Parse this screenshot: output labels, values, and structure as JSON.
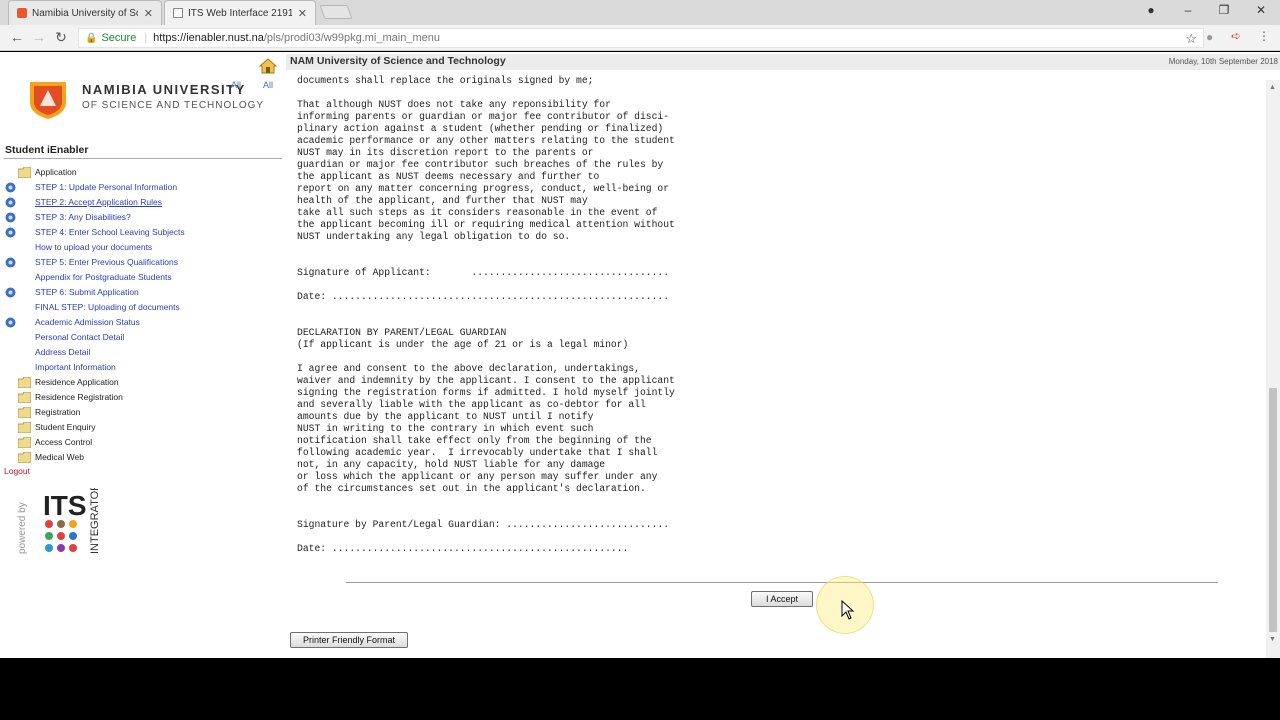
{
  "browser": {
    "tabs": [
      {
        "title": "Namibia University of Sci",
        "active": false
      },
      {
        "title": "ITS Web Interface 21911",
        "active": true
      }
    ],
    "secure_label": "Secure",
    "url_host": "https://ienabler.nust.na",
    "url_path": "/pls/prodi03/w99pkg.mi_main_menu"
  },
  "sidebar": {
    "logo_line1": "NAMIBIA UNIVERSITY",
    "logo_line2": "OF SCIENCE AND TECHNOLOGY",
    "all_links": [
      "All",
      "All"
    ],
    "title": "Student iEnabler",
    "menu": [
      {
        "label": "Application",
        "type": "folder"
      },
      {
        "label": "STEP 1: Update Personal Information",
        "type": "step"
      },
      {
        "label": "STEP 2: Accept Application Rules",
        "type": "step",
        "current": true
      },
      {
        "label": "STEP 3: Any Disabilities?",
        "type": "step"
      },
      {
        "label": "STEP 4: Enter School Leaving Subjects",
        "type": "step"
      },
      {
        "label": "How to upload your documents",
        "type": "link"
      },
      {
        "label": "STEP 5: Enter Previous Qualifications",
        "type": "step"
      },
      {
        "label": "Appendix for Postgraduate Students",
        "type": "link"
      },
      {
        "label": "STEP 6: Submit Application",
        "type": "step"
      },
      {
        "label": "FINAL STEP: Uploading of documents",
        "type": "link"
      },
      {
        "label": "Academic Admission Status",
        "type": "step"
      },
      {
        "label": "Personal Contact Detail",
        "type": "link"
      },
      {
        "label": "Address Detail",
        "type": "link"
      },
      {
        "label": "Important Information",
        "type": "link"
      },
      {
        "label": "Residence Application",
        "type": "folder"
      },
      {
        "label": "Residence Registration",
        "type": "folder"
      },
      {
        "label": "Registration",
        "type": "folder"
      },
      {
        "label": "Student Enquiry",
        "type": "folder"
      },
      {
        "label": "Access Control",
        "type": "folder"
      },
      {
        "label": "Medical Web",
        "type": "folder"
      }
    ],
    "logout": "Logout",
    "powered_by": "powered by",
    "its": "ITS",
    "integrator": "INTEGRATOR"
  },
  "header": {
    "org": "NAM University of Science and Technology",
    "date": "Monday, 10th September 2018"
  },
  "document_text": "documents shall replace the originals signed by me;\n\nThat although NUST does not take any reponsibility for\ninforming parents or guardian or major fee contributor of disci-\nplinary action against a student (whether pending or finalized)\nacademic performance or any other matters relating to the student\nNUST may in its discretion report to the parents or\nguardian or major fee contributor such breaches of the rules by\nthe applicant as NUST deems necessary and further to\nreport on any matter concerning progress, conduct, well-being or\nhealth of the applicant, and further that NUST may\ntake all such steps as it considers reasonable in the event of\nthe applicant becoming ill or requiring medical attention without\nNUST undertaking any legal obligation to do so.\n\n\nSignature of Applicant:       ..................................\n\nDate: ..........................................................\n\n\nDECLARATION BY PARENT/LEGAL GUARDIAN\n(If applicant is under the age of 21 or is a legal minor)\n\nI agree and consent to the above declaration, undertakings,\nwaiver and indemnity by the applicant. I consent to the applicant\nsigning the registration forms if admitted. I hold myself jointly\nand severally liable with the applicant as co-debtor for all\namounts due by the applicant to NUST until I notify\nNUST in writing to the contrary in which event such\nnotification shall take effect only from the beginning of the\nfollowing academic year.  I irrevocably undertake that I shall\nnot, in any capacity, hold NUST liable for any damage\nor loss which the applicant or any person may suffer under any\nof the circumstances set out in the applicant's declaration.\n\n\nSignature by Parent/Legal Guardian: ............................\n\nDate: ...................................................",
  "buttons": {
    "accept": "I Accept",
    "print": "Printer Friendly Format"
  }
}
